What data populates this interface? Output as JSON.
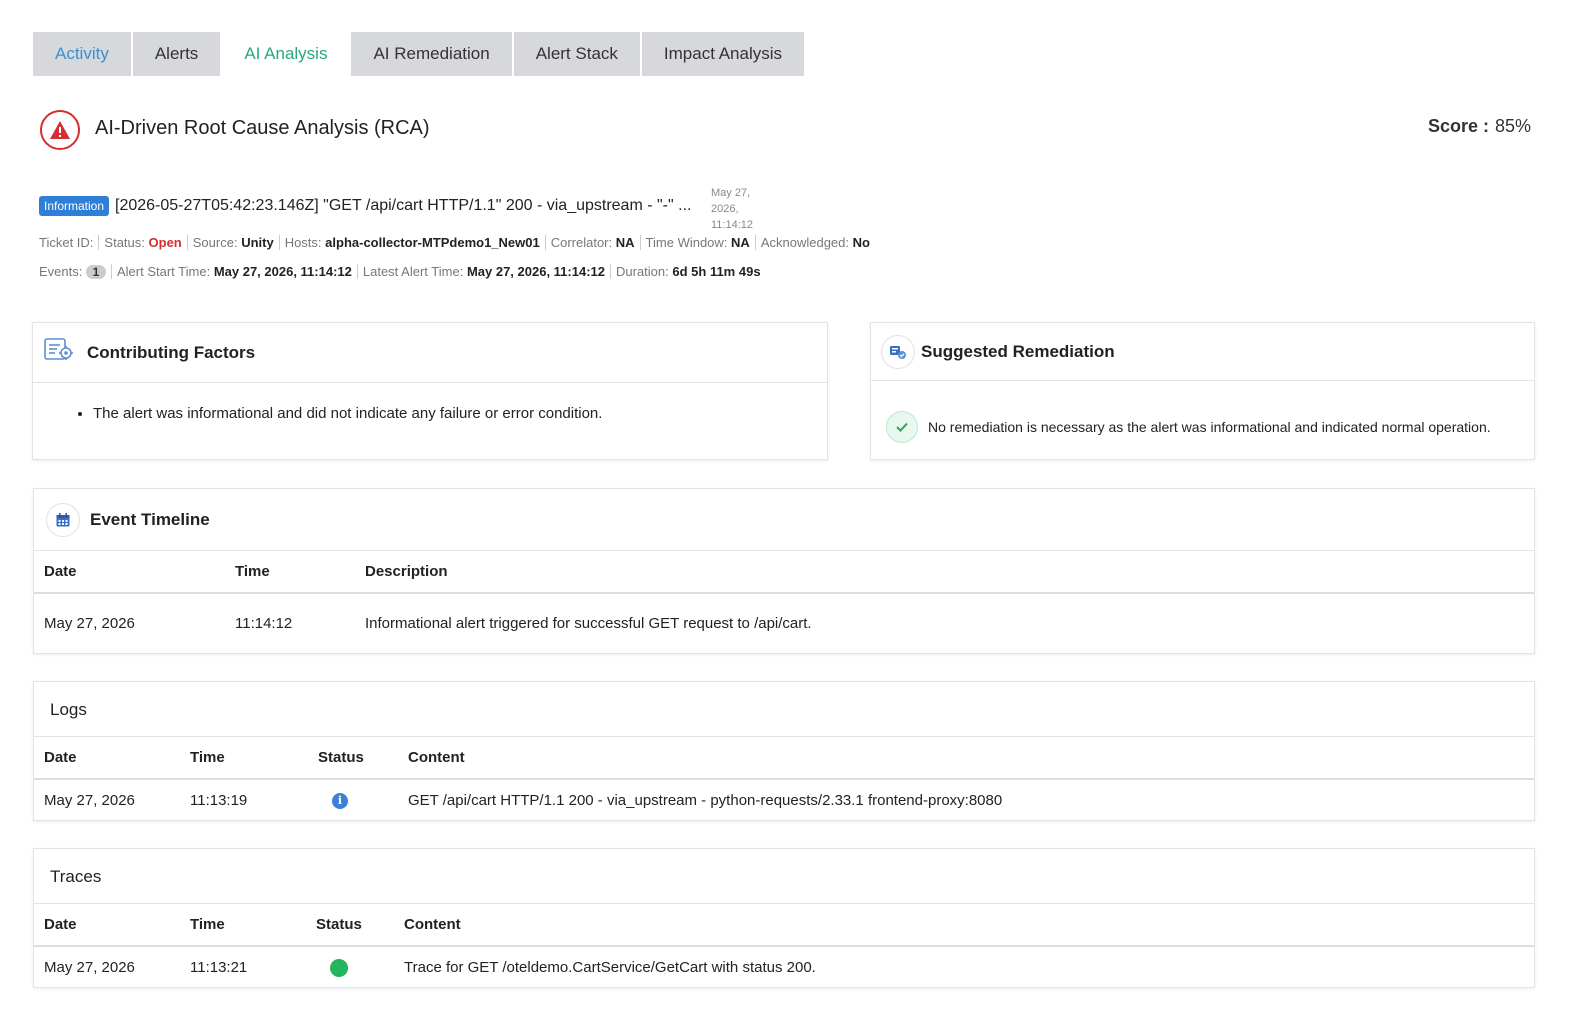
{
  "tabs": [
    {
      "label": "Activity"
    },
    {
      "label": "Alerts"
    },
    {
      "label": "AI Analysis"
    },
    {
      "label": "AI Remediation"
    },
    {
      "label": "Alert Stack"
    },
    {
      "label": "Impact Analysis"
    }
  ],
  "header": {
    "title": "AI-Driven Root Cause Analysis (RCA)",
    "score_label": "Score :",
    "score_value": "85%"
  },
  "alert": {
    "badge": "Information",
    "title": "[2026-05-27T05:42:23.146Z] \"GET /api/cart HTTP/1.1\" 200 - via_upstream - \"-\" ...",
    "date_line1": "May 27,",
    "date_line2": "2026,",
    "date_line3": "11:14:12",
    "ticket_label": "Ticket ID:",
    "status_label": "Status:",
    "status_value": "Open",
    "source_label": "Source:",
    "source_value": "Unity",
    "hosts_label": "Hosts:",
    "hosts_value": "alpha-collector-MTPdemo1_New01",
    "correlator_label": "Correlator:",
    "correlator_value": "NA",
    "window_label": "Time Window:",
    "window_value": "NA",
    "ack_label": "Acknowledged:",
    "ack_value": "No",
    "events_label": "Events:",
    "events_value": "1",
    "start_label": "Alert Start Time:",
    "start_value": "May 27, 2026, 11:14:12",
    "latest_label": "Latest Alert Time:",
    "latest_value": "May 27, 2026, 11:14:12",
    "duration_label": "Duration:",
    "duration_value": "6d 5h 11m 49s"
  },
  "contributing": {
    "title": "Contributing Factors",
    "items": [
      "The alert was informational and did not indicate any failure or error condition."
    ]
  },
  "remediation": {
    "title": "Suggested Remediation",
    "text": "No remediation is necessary as the alert was informational and indicated normal operation."
  },
  "timeline": {
    "title": "Event Timeline",
    "headers": [
      "Date",
      "Time",
      "Description"
    ],
    "rows": [
      {
        "date": "May 27, 2026",
        "time": "11:14:12",
        "description": "Informational alert triggered for successful GET request to /api/cart."
      }
    ]
  },
  "logs": {
    "title": "Logs",
    "headers": [
      "Date",
      "Time",
      "Status",
      "Content"
    ],
    "rows": [
      {
        "date": "May 27, 2026",
        "time": "11:13:19",
        "status": "info",
        "content": "GET /api/cart HTTP/1.1 200 - via_upstream - python-requests/2.33.1 frontend-proxy:8080"
      }
    ]
  },
  "traces": {
    "title": "Traces",
    "headers": [
      "Date",
      "Time",
      "Status",
      "Content"
    ],
    "rows": [
      {
        "date": "May 27, 2026",
        "time": "11:13:21",
        "status": "ok",
        "content": "Trace for GET /oteldemo.CartService/GetCart with status 200."
      }
    ]
  },
  "colors": {
    "accent_green": "#27a97b",
    "activity_blue": "#3a8fd6",
    "danger_red": "#d32f2f",
    "info_blue": "#2f7ed8",
    "success_green": "#22b55e"
  }
}
